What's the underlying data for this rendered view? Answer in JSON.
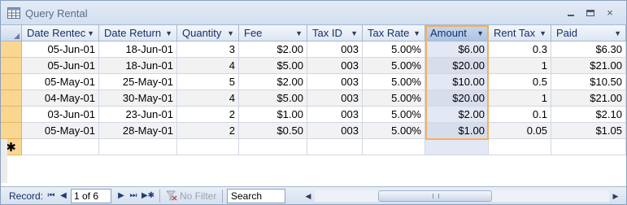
{
  "window": {
    "title": "Query Rental",
    "minimize_icon": "minimize-icon",
    "maximize_icon": "maximize-icon",
    "close_label": "×"
  },
  "columns": [
    {
      "key": "date_rented",
      "label": "Date Rentec"
    },
    {
      "key": "date_return",
      "label": "Date Return"
    },
    {
      "key": "quantity",
      "label": "Quantity"
    },
    {
      "key": "fee",
      "label": "Fee"
    },
    {
      "key": "tax_id",
      "label": "Tax ID"
    },
    {
      "key": "tax_rate",
      "label": "Tax Rate"
    },
    {
      "key": "amount",
      "label": "Amount"
    },
    {
      "key": "rent_tax",
      "label": "Rent Tax"
    },
    {
      "key": "paid",
      "label": "Paid"
    }
  ],
  "rows": [
    [
      "05-Jun-01",
      "18-Jun-01",
      "3",
      "$2.00",
      "003",
      "5.00%",
      "$6.00",
      "0.3",
      "$6.30"
    ],
    [
      "05-Jun-01",
      "18-Jun-01",
      "4",
      "$5.00",
      "003",
      "5.00%",
      "$20.00",
      "1",
      "$21.00"
    ],
    [
      "05-May-01",
      "25-May-01",
      "5",
      "$2.00",
      "003",
      "5.00%",
      "$10.00",
      "0.5",
      "$10.50"
    ],
    [
      "04-May-01",
      "30-May-01",
      "4",
      "$5.00",
      "003",
      "5.00%",
      "$20.00",
      "1",
      "$21.00"
    ],
    [
      "03-Jun-01",
      "23-Jun-01",
      "2",
      "$1.00",
      "003",
      "5.00%",
      "$2.00",
      "0.1",
      "$2.10"
    ],
    [
      "05-May-01",
      "28-May-01",
      "2",
      "$0.50",
      "003",
      "5.00%",
      "$1.00",
      "0.05",
      "$1.05"
    ]
  ],
  "new_record_marker": "✱",
  "selected_column": "Amount",
  "navigation": {
    "record_label": "Record:",
    "first": "⏮",
    "previous": "◀",
    "position": "1 of 6",
    "next": "▶",
    "last": "⏭",
    "new": "▶✱",
    "filter_label": "No Filter",
    "search_value": "Search"
  },
  "colors": {
    "accent_selector": "#fbd690",
    "selected_column_border": "#f3b05f",
    "header_text": "#15306a"
  }
}
